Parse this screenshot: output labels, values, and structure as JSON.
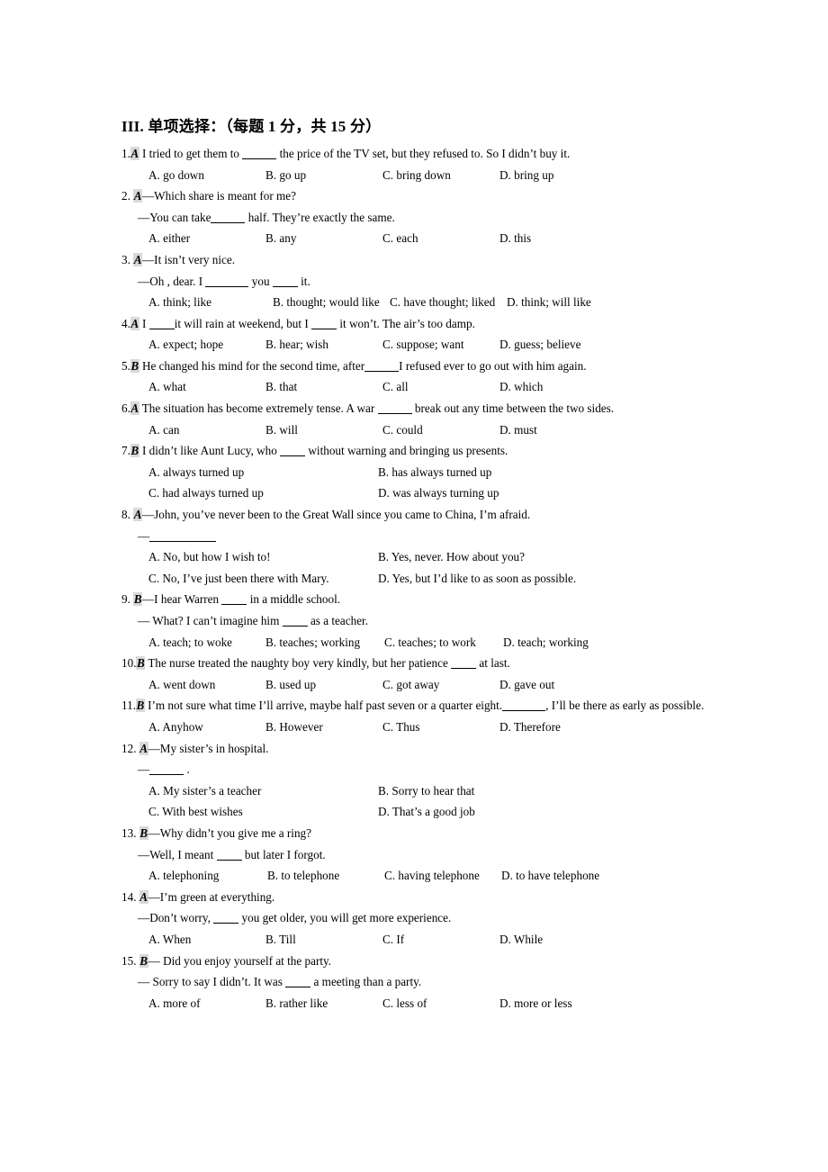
{
  "section": {
    "heading": "III. 单项选择：（每题 1 分，共 15 分）"
  },
  "questions": [
    {
      "num": "1.",
      "answer": "A",
      "stem_pre": "I tried to get them to",
      "stem_post": "the price of the TV set, but they refused to. So I didn’t buy it.",
      "options": [
        "A. go down",
        "B. go up",
        "C. bring down",
        "D. bring up"
      ],
      "layout": "four"
    },
    {
      "num": "2.",
      "answer": "A",
      "stem_pre": "—Which share is meant for me?",
      "sub_pre": "—You can take",
      "sub_post": "half. They’re exactly the same.",
      "options": [
        "A. either",
        "B. any",
        "C. each",
        "D. this"
      ],
      "layout": "four"
    },
    {
      "num": "3.",
      "answer": "A",
      "stem_pre": "—It isn’t very nice.",
      "sub_pre": "—Oh , dear. I",
      "sub_mid": "you",
      "sub_post": "it.",
      "options": [
        "A. think; like",
        "B. thought; would like",
        "C. have thought; liked",
        "D. think; will like"
      ],
      "layout": "four-tight"
    },
    {
      "num": "4.",
      "answer": "A",
      "stem_pre": "I",
      "stem_mid": "it will rain at weekend, but I",
      "stem_post": "it won’t. The air’s too damp.",
      "options": [
        "A. expect; hope",
        "B. hear; wish",
        "C. suppose; want",
        "D. guess; believe"
      ],
      "layout": "four"
    },
    {
      "num": "5.",
      "answer": "B",
      "stem_pre": "He changed his mind for the second time, after",
      "stem_post": "I refused ever to go out with him again.",
      "options": [
        "A. what",
        "B. that",
        "C. all",
        "D. which"
      ],
      "layout": "four"
    },
    {
      "num": "6.",
      "answer": "A",
      "stem_pre": "The situation has become extremely tense. A war",
      "stem_post": "break out any time between the two sides.",
      "options": [
        "A. can",
        "B. will",
        "C. could",
        "D. must"
      ],
      "layout": "four"
    },
    {
      "num": "7.",
      "answer": "B",
      "stem_pre": "I didn’t like Aunt Lucy, who",
      "stem_post": "without warning and bringing us presents.",
      "options": [
        "A. always turned up",
        "B. has always turned up",
        "C. had always turned up",
        "D. was always turning up"
      ],
      "layout": "two-by-two"
    },
    {
      "num": "8.",
      "answer": "A",
      "stem_pre": "—John, you’ve never been to the Great Wall since you came to China, I’m afraid.",
      "sub_pre": "—",
      "options": [
        "A. No, but how I wish to!",
        "B. Yes, never. How about you?",
        "C. No, I’ve just been there with Mary.",
        "D. Yes, but I’d like to as soon as possible."
      ],
      "layout": "two-by-two"
    },
    {
      "num": "9.",
      "answer": "B",
      "stem_pre": "—I hear Warren",
      "stem_post": "in a middle school.",
      "sub_pre": "— What? I can’t imagine him",
      "sub_post": "as a teacher.",
      "options": [
        "A. teach; to woke",
        "B. teaches; working",
        "C. teaches; to work",
        "D. teach; working"
      ],
      "layout": "four-tight"
    },
    {
      "num": "10.",
      "answer": "B",
      "stem_pre": "The nurse treated the naughty boy very kindly, but her patience",
      "stem_post": "at last.",
      "options": [
        "A. went down",
        "B. used up",
        "C. got away",
        "D. gave out"
      ],
      "layout": "four"
    },
    {
      "num": "11.",
      "answer": "B",
      "stem_pre": "I’m not sure what time I’ll arrive, maybe half past seven or a quarter eight.",
      "stem_post": ", I’ll be there as early as possible.",
      "options": [
        "A. Anyhow",
        "B. However",
        "C. Thus",
        "D. Therefore"
      ],
      "layout": "four"
    },
    {
      "num": "12.",
      "answer": "A",
      "stem_pre": "—My sister’s in hospital.",
      "sub_pre": "—",
      "sub_post": ".",
      "options": [
        "A. My sister’s a teacher",
        "B. Sorry to hear that",
        "C. With best wishes",
        "D. That’s a good job"
      ],
      "layout": "two-by-two"
    },
    {
      "num": "13.",
      "answer": "B",
      "stem_pre": "—Why didn’t you give me a ring?",
      "sub_pre": "—Well, I meant",
      "sub_post": "but later I forgot.",
      "options": [
        "A. telephoning",
        "B. to telephone",
        "C. having telephone",
        "D. to have telephone"
      ],
      "layout": "four-tight"
    },
    {
      "num": "14.",
      "answer": "A",
      "stem_pre": "—I’m green at everything.",
      "sub_pre": "—Don’t worry,",
      "sub_post": "you get older, you will get more experience.",
      "options": [
        "A. When",
        "B. Till",
        "C. If",
        "D. While"
      ],
      "layout": "four"
    },
    {
      "num": "15.",
      "answer": "B",
      "stem_pre": "— Did you enjoy yourself at the party.",
      "sub_pre": "— Sorry to say I didn’t. It was",
      "sub_post": "a meeting than a party.",
      "options": [
        "A. more of",
        "B. rather like",
        "C. less of",
        "D. more or less"
      ],
      "layout": "four"
    }
  ]
}
